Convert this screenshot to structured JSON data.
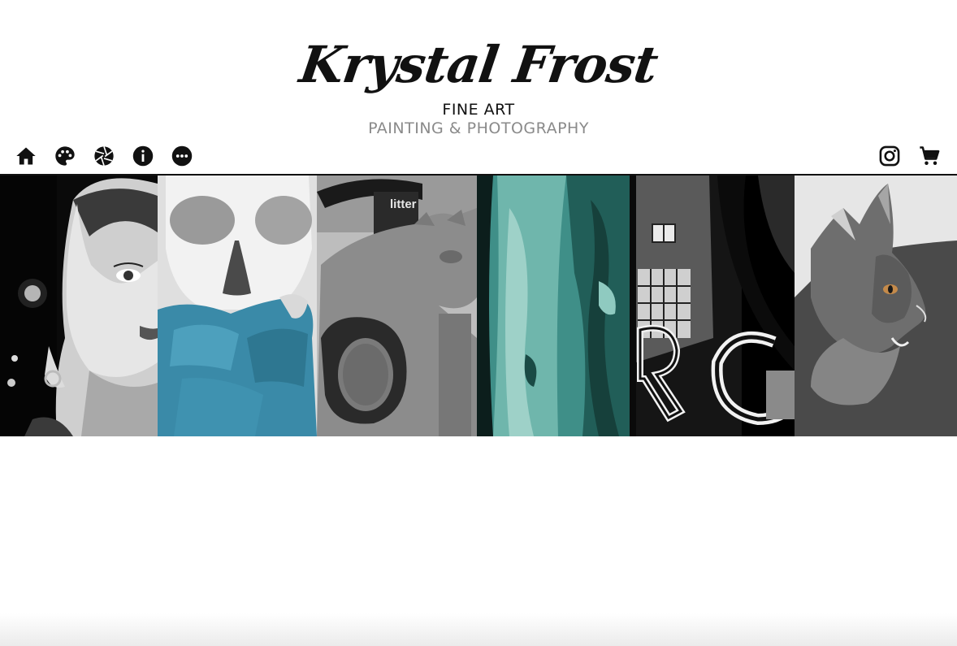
{
  "header": {
    "logo_text": "Krystal Frost",
    "tagline_primary": "FINE ART",
    "tagline_secondary": "PAINTING & PHOTOGRAPHY"
  },
  "nav": {
    "left_icons": [
      "home-icon",
      "palette-icon",
      "aperture-icon",
      "info-icon",
      "more-icon"
    ],
    "right_icons": [
      "instagram-icon",
      "cart-icon"
    ]
  },
  "gallery": {
    "tiles": [
      {
        "subject": "woman-portrait"
      },
      {
        "subject": "skull-painting"
      },
      {
        "subject": "cat-statue"
      },
      {
        "subject": "teal-abstract"
      },
      {
        "subject": "neon-sign"
      },
      {
        "subject": "cat-painting"
      }
    ],
    "litter_sign": "litter"
  },
  "colors": {
    "text": "#111111",
    "tagline_grey": "#8a8a8a",
    "accent_teal": "#3a8aa8"
  }
}
